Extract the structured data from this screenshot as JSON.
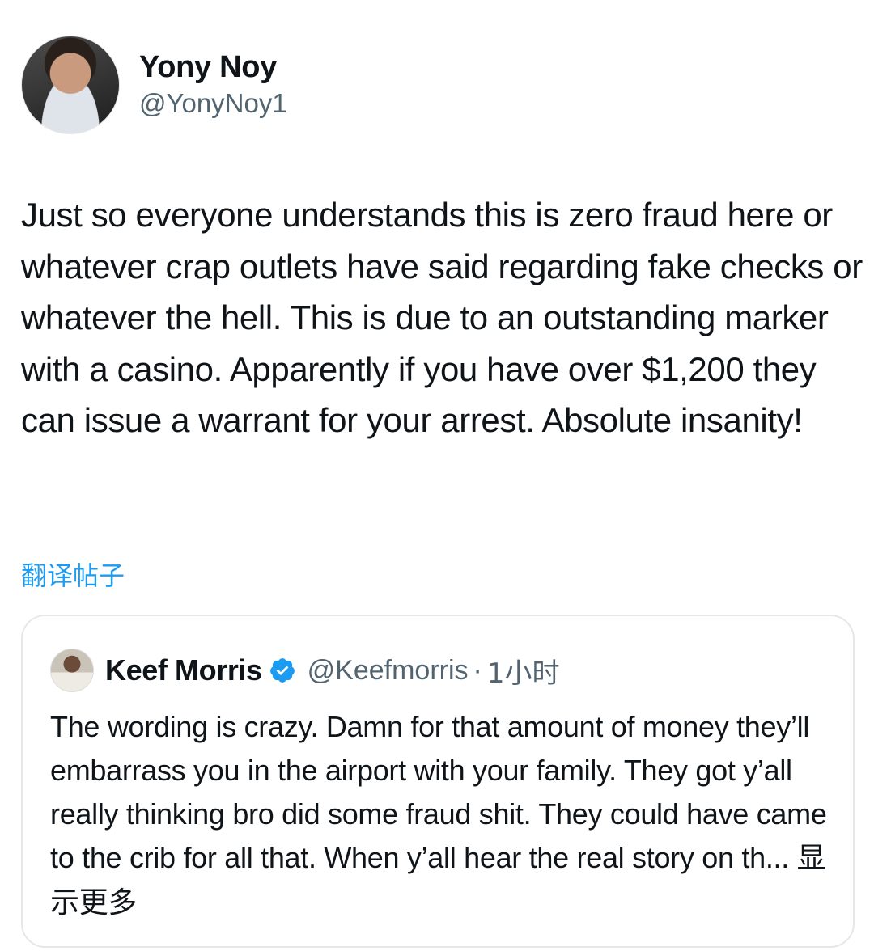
{
  "author": {
    "display_name": "Yony Noy",
    "handle": "@YonyNoy1"
  },
  "tweet": {
    "text": "Just so everyone understands this is zero fraud here or whatever crap outlets have said regarding fake checks or whatever the hell. This is due to an outstanding marker with a casino. Apparently if you have over $1,200 they can issue a warrant for your arrest. Absolute insanity!",
    "translate_label": "翻译帖子"
  },
  "quote": {
    "display_name": "Keef Morris",
    "handle": "@Keefmorris",
    "separator": "·",
    "time": "1小时",
    "text": "The wording is crazy. Damn for that amount of money they’ll embarrass you in the airport with your family. They got y’all really thinking bro did some fraud shit. They could have came to the crib for all that. When y’all hear the real story on th...",
    "show_more_label": "显示更多",
    "verified_icon": "verified-badge-icon"
  },
  "colors": {
    "link": "#1d9bf0",
    "secondary_text": "#536471",
    "border": "#e5e8eb"
  }
}
